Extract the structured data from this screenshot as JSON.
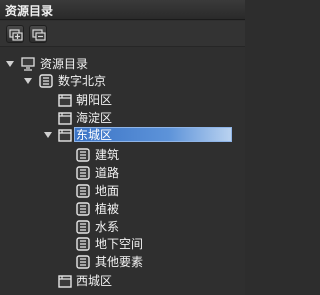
{
  "panel": {
    "title": "资源目录"
  },
  "toolbar": {
    "buttons": [
      {
        "icon": "expand-all-icon"
      },
      {
        "icon": "collapse-all-icon"
      }
    ]
  },
  "tree": {
    "root": {
      "label": "资源目录",
      "icon": "monitor-icon",
      "expanded": true
    },
    "city": {
      "label": "数字北京",
      "icon": "document-stack-icon",
      "expanded": true
    },
    "districts": [
      {
        "label": "朝阳区"
      },
      {
        "label": "海淀区"
      },
      {
        "label": "东城区",
        "expanded": true,
        "selected": true
      },
      {
        "label": "西城区"
      }
    ],
    "layers": [
      {
        "label": "建筑"
      },
      {
        "label": "道路"
      },
      {
        "label": "地面"
      },
      {
        "label": "植被"
      },
      {
        "label": "水系"
      },
      {
        "label": "地下空间"
      },
      {
        "label": "其他要素"
      }
    ]
  },
  "colors": {
    "background": "#2f2f2f",
    "selection": "#5d93d9",
    "text": "#f2f2f2"
  }
}
